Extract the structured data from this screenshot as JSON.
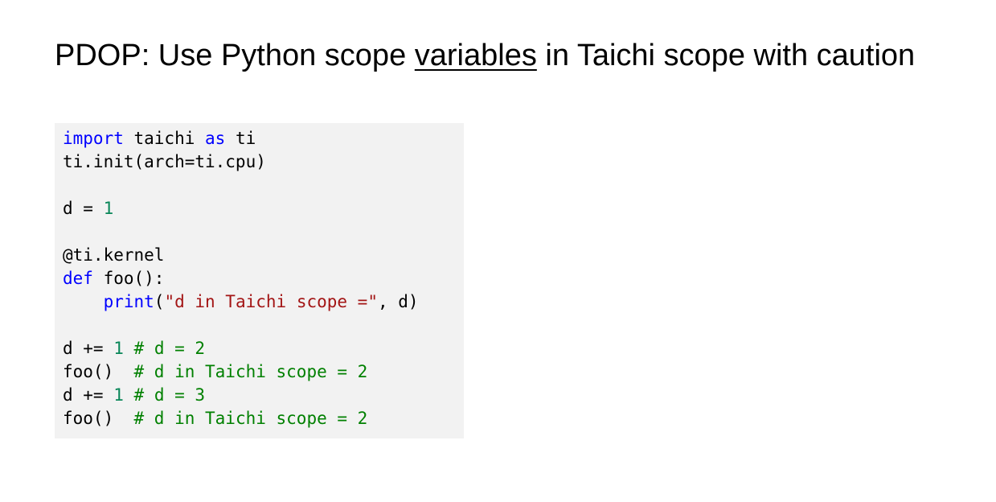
{
  "title": {
    "prefix": "PDOP: Use Python scope ",
    "underlined": "variables",
    "suffix": " in Taichi scope with caution"
  },
  "code": {
    "line1": {
      "kw1": "import",
      "t1": " taichi ",
      "kw2": "as",
      "t2": " ti"
    },
    "line2": {
      "t1": "ti.init(arch=ti.cpu)"
    },
    "line4": {
      "t1": "d = ",
      "n1": "1"
    },
    "line6": {
      "t1": "@ti.kernel"
    },
    "line7": {
      "kw1": "def",
      "t1": " foo():"
    },
    "line8": {
      "indent": "    ",
      "kw1": "print",
      "t1": "(",
      "s1": "\"d in Taichi scope =\"",
      "t2": ", d)"
    },
    "line10": {
      "t1": "d += ",
      "n1": "1",
      "t2": " ",
      "c1": "# d = 2"
    },
    "line11": {
      "t1": "foo()  ",
      "c1": "# d in Taichi scope = 2"
    },
    "line12": {
      "t1": "d += ",
      "n1": "1",
      "t2": " ",
      "c1": "# d = 3"
    },
    "line13": {
      "t1": "foo()  ",
      "c1": "# d in Taichi scope = 2"
    }
  },
  "colors": {
    "keyword": "#0000ff",
    "number": "#098658",
    "string": "#a31515",
    "comment": "#008000",
    "code_background": "#f2f2f2"
  }
}
